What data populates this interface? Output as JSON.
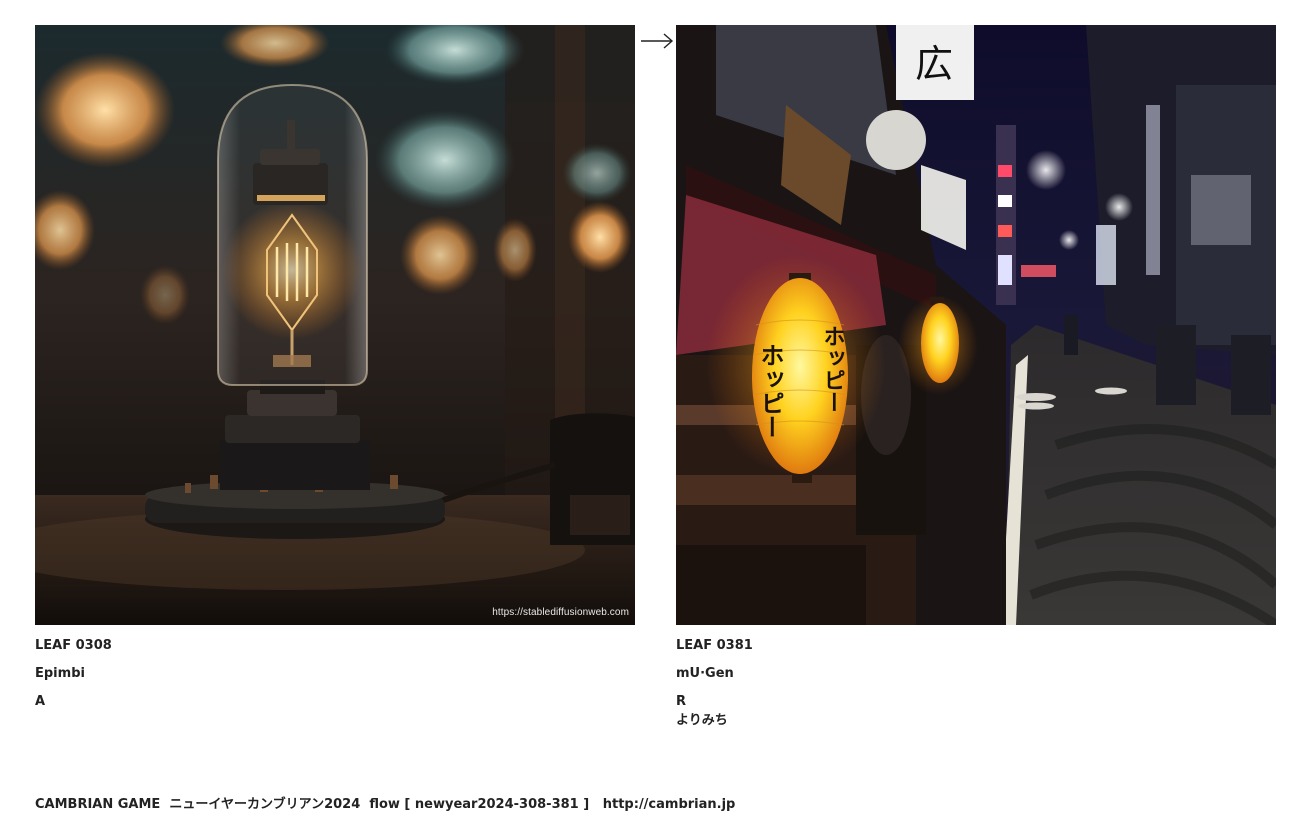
{
  "left_card": {
    "watermark": "https://stablediffusionweb.com",
    "code": "LEAF 0308",
    "author": "Epimbi",
    "mark": "A"
  },
  "arrow": {
    "icon": "right-arrow-icon"
  },
  "right_card": {
    "code": "LEAF 0381",
    "author": "mU·Gen",
    "mark": "R",
    "title": "よりみち",
    "lantern_text": "ホッピー",
    "sign_text": "広"
  },
  "footer": {
    "brand": "CAMBRIAN GAME",
    "event": "ニューイヤーカンブリアン2024",
    "flow": "flow [ newyear2024-308-381 ]",
    "url": "http://cambrian.jp"
  },
  "colors": {
    "text": "#222222",
    "lamp_glow": "#ffb347",
    "lantern": "#ffd21f"
  }
}
